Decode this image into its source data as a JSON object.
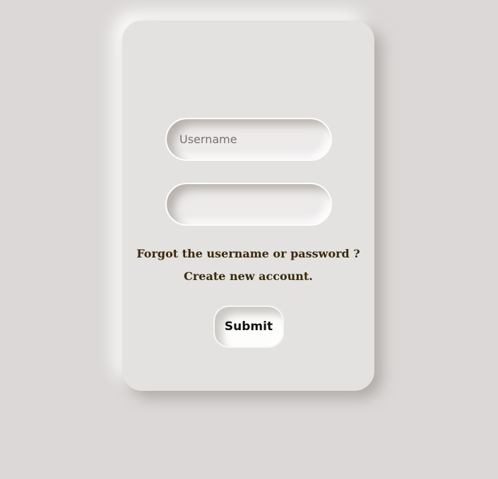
{
  "form": {
    "username_placeholder": "Username",
    "password_placeholder": "",
    "forgot_link": "Forgot the username or password ?",
    "create_link": "Create new account.",
    "submit_label": "Submit"
  },
  "colors": {
    "background": "#dbd8d7",
    "card": "#e3e2e0",
    "link_text": "#3a2a0a"
  }
}
